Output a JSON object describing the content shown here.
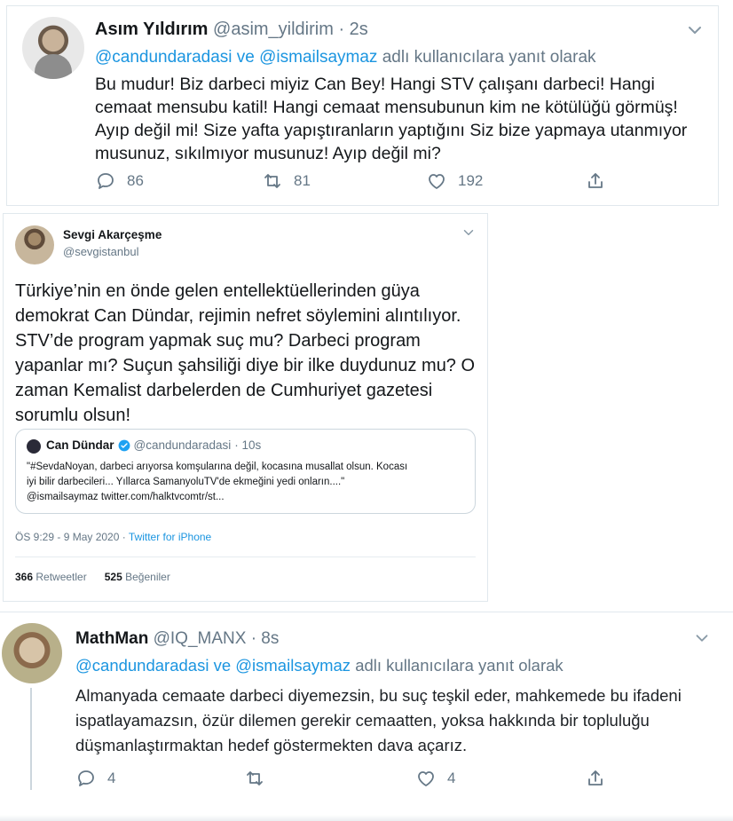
{
  "tweet1": {
    "name": "Asım Yıldırım",
    "handle": "@asim_yildirim",
    "time": "· 2s",
    "reply_to": "@candundaradasi ve @ismailsaymaz",
    "reply_suffix": " adlı kullanıcılara yanıt olarak",
    "body": "Bu mudur! Biz darbeci miyiz Can Bey! Hangi STV çalışanı darbeci! Hangi cemaat mensubu katil! Hangi cemaat mensubunun kim ne kötülüğü görmüş! Ayıp değil mi! Size yafta yapıştıranların yaptığını Siz bize yapmaya utanmıyor musunuz, sıkılmıyor musunuz! Ayıp değil mi?",
    "replies": "86",
    "retweets": "81",
    "likes": "192"
  },
  "tweet2": {
    "name": "Sevgi Akarçeşme",
    "handle": "@sevgistanbul",
    "body": "Türkiye’nin en önde gelen entellektüellerinden güya demokrat Can Dündar, rejimin nefret söylemini alıntılıyor. STV’de program yapmak suç mu? Darbeci program yapanlar mı? Suçun şahsiliği diye bir ilke duydunuz mu? O zaman Kemalist darbelerden de Cumhuriyet gazetesi sorumlu olsun!",
    "quote": {
      "name": "Can Dündar",
      "handle": "@candundaradasi",
      "time": "· 10s",
      "line1": "\"#SevdaNoyan, darbeci arıyorsa komşularına değil, kocasına musallat olsun. Kocası",
      "line2": "iyi bilir darbecileri... Yıllarca SamanyoluTV'de ekmeğini yedi onların....\"",
      "line3": "@ismailsaymaz twitter.com/halktvcomtr/st..."
    },
    "timestamp": "ÖS 9:29 - 9 May 2020 · ",
    "source": "Twitter for iPhone",
    "retweets_count": "366",
    "retweets_label": " Retweetler",
    "likes_count": "525",
    "likes_label": " Beğeniler"
  },
  "tweet3": {
    "name": "MathMan",
    "handle": "@IQ_MANX",
    "time": "· 8s",
    "reply_to": "@candundaradasi ve @ismailsaymaz",
    "reply_suffix": " adlı kullanıcılara yanıt olarak",
    "body": "Almanyada cemaate darbeci diyemezsin, bu suç teşkil eder, mahkemede bu ifadeni ispatlayamazsın, özür dilemen gerekir cemaatten, yoksa hakkında bir topluluğu düşmanlaştırmaktan hedef göstermekten dava açarız.",
    "replies": "4",
    "retweets": "",
    "likes": "4"
  },
  "colors": {
    "link": "#1b95e0",
    "muted": "#657786",
    "verified": "#1da1f2"
  },
  "icons": [
    "reply-icon",
    "retweet-icon",
    "like-icon",
    "share-icon",
    "chevron-down-icon",
    "verified-icon"
  ]
}
